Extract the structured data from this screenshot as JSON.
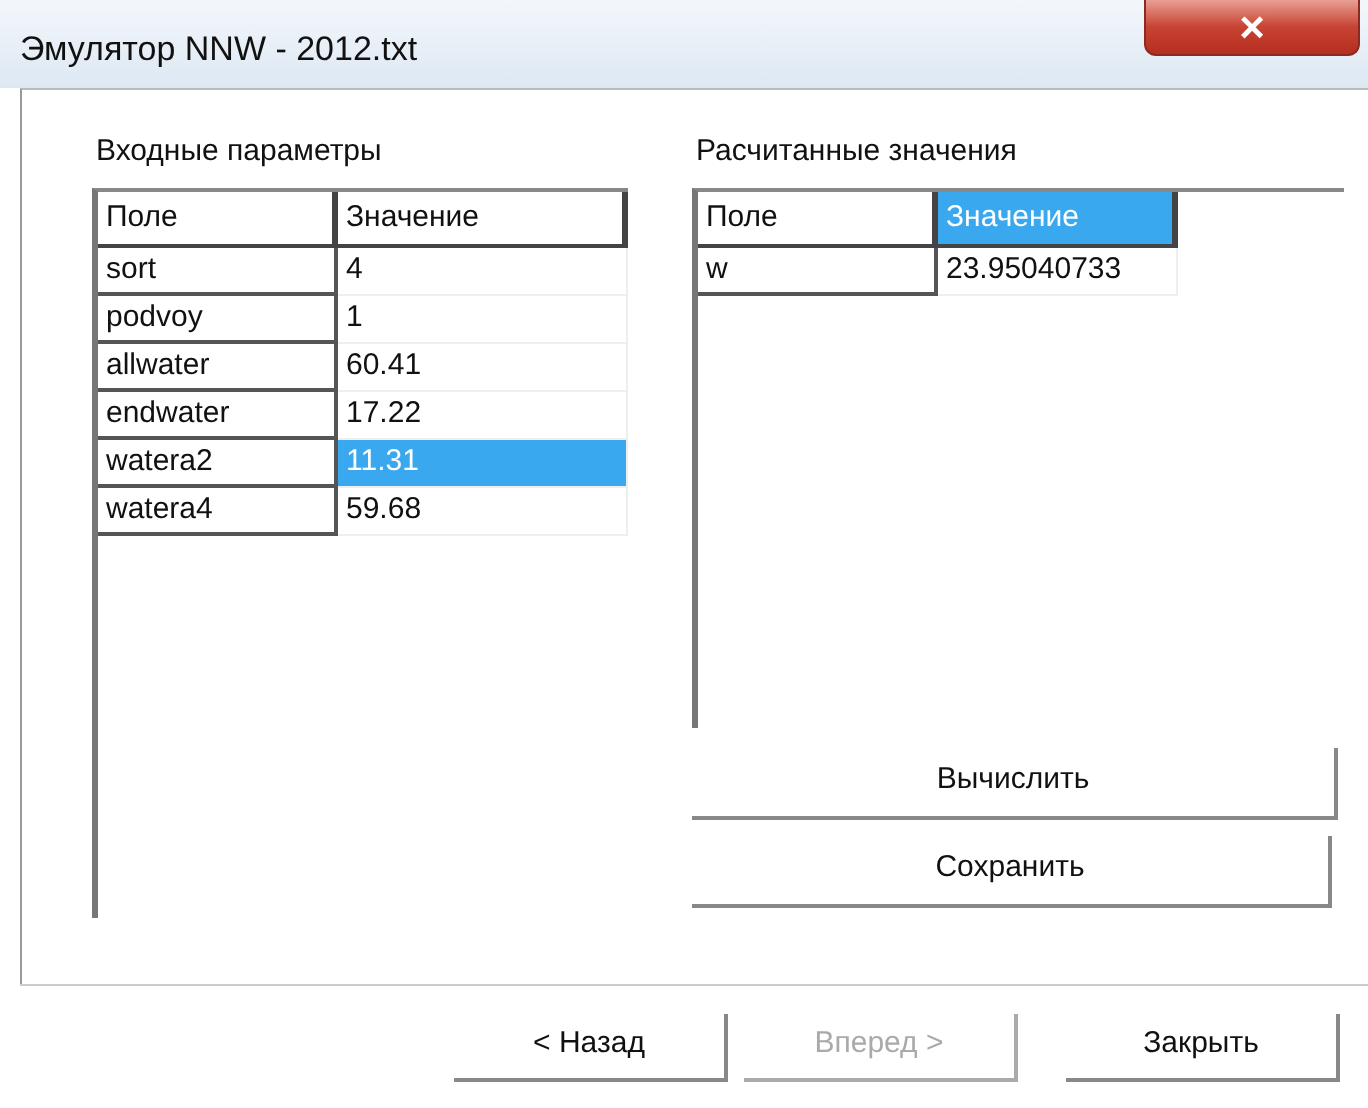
{
  "window": {
    "title": "Эмулятор NNW - 2012.txt",
    "close": "×"
  },
  "input_grid": {
    "label": "Входные параметры",
    "columns": [
      {
        "label": "Поле",
        "selected": false
      },
      {
        "label": "Значение",
        "selected": false
      }
    ],
    "rows": [
      {
        "field": "sort",
        "value": "4",
        "selected": false
      },
      {
        "field": "podvoy",
        "value": "1",
        "selected": false
      },
      {
        "field": "allwater",
        "value": "60.41",
        "selected": false
      },
      {
        "field": "endwater",
        "value": "17.22",
        "selected": false
      },
      {
        "field": "watera2",
        "value": "11.31",
        "selected": true
      },
      {
        "field": "watera4",
        "value": "59.68",
        "selected": false
      }
    ]
  },
  "output_grid": {
    "label": "Расчитанные значения",
    "columns": [
      {
        "label": "Поле",
        "selected": false
      },
      {
        "label": "Значение",
        "selected": true
      }
    ],
    "rows": [
      {
        "field": "w",
        "value": "23.95040733",
        "selected": false
      }
    ]
  },
  "actions": [
    {
      "label": "Вычислить",
      "disabled": false
    },
    {
      "label": "Сохранить",
      "disabled": false
    }
  ],
  "footer_buttons": [
    {
      "label": "< Назад",
      "disabled": false
    },
    {
      "label": "Вперед >",
      "disabled": true
    },
    {
      "label": "Закрыть",
      "disabled": false
    }
  ]
}
